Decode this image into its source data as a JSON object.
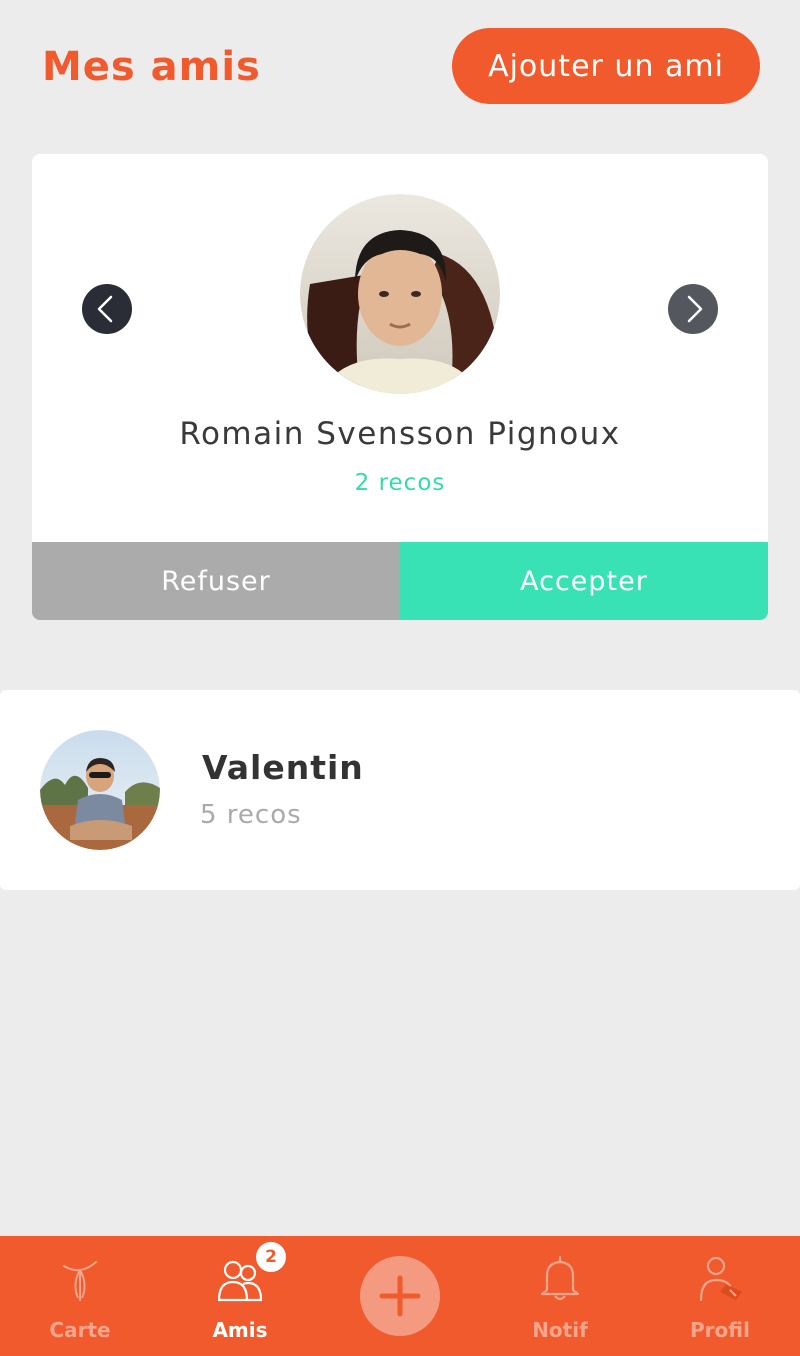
{
  "header": {
    "title": "Mes amis",
    "add_friend_label": "Ajouter un ami"
  },
  "request": {
    "name": "Romain Svensson Pignoux",
    "recos": "2 recos",
    "refuse_label": "Refuser",
    "accept_label": "Accepter"
  },
  "friends": [
    {
      "name": "Valentin",
      "recos": "5 recos"
    }
  ],
  "tabbar": {
    "items": [
      {
        "label": "Carte",
        "icon": "map-pin-icon"
      },
      {
        "label": "Amis",
        "icon": "friends-icon",
        "badge": "2"
      },
      {
        "label": "",
        "icon": "plus-icon"
      },
      {
        "label": "Notif",
        "icon": "bell-icon"
      },
      {
        "label": "Profil",
        "icon": "profile-edit-icon"
      }
    ]
  },
  "colors": {
    "brand": "#f05a2c",
    "accept": "#38e2b4",
    "refuse": "#ababab",
    "recos_accent": "#36d9a8"
  }
}
